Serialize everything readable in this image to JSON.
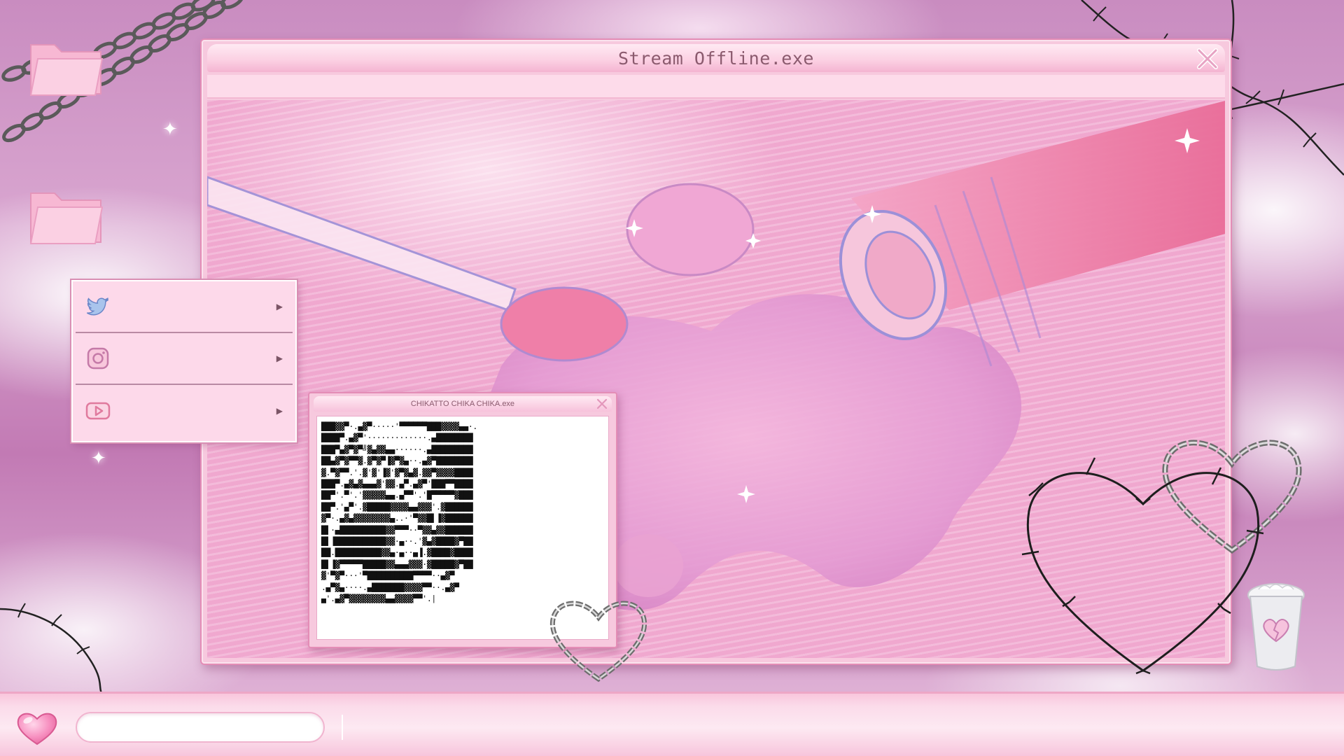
{
  "main_window": {
    "title": "Stream Offline.exe",
    "close_icon": "close-icon"
  },
  "terminal_window": {
    "title": "CHIKATTO CHIKA CHIKA.exe",
    "close_icon": "close-icon",
    "ascii_art": "███▓▓▀·.▄▓▀·····'▀▀▀▀▀▀███▓▓▓▓▄▄·.\n████▀.▄▓▀'·············.▄████████\n███▀▄▓▀▓▀╝▓▄▓▓▄▄······.▄█████████\n██▄▓▀▓▀▀▓.▓▀▓▀▐▓▀▓▄··.▄▓▀████████\n▓.▀▓▀▀.'.▓'▓'▐▓'▓▀▓▄▓.▓▓▀▓▓▓▓████\n███▀.▄▓▄▓▄▄▄▓'▓▓.▄▀.▄▓▀'███▀▀████\n██▀'.▀'.'▓▓▓▓▓▄▄.▄▀▀'.'█▀▀▀▀▀▓███\n██▀.'▄▀'.▓█████▓▓▓▓▄▄▓▓▓'.▓██████\n▓▀·.▄▓▄▓▓▓▓▓▓▓▓▄..·'▀▓▓█▌▐▓██████\n█▌·▄██████████▓▓▀▀▀··▀▓▓▄▓▓██████\n█▌▐███████████▓▓·▄··.'▓▄▓████▓▀██\n██.██████████▓▓▄·▄··▄▐.▓████▓████\n█▌▐▓▀▀▀▀▀█████▓▓▄▄▄▓▓▓·▓█████▓▀██\n▓'▀▓▀···'▀██████████▀▀▀▀··▄▓▀\n.▄▀▓▄····.▄███████▓▓▓▓▀▀··.▄▓▀\n▄'.▄▓▀▓▓▓▓▓▓▓▓▄▄▓▓▓▓▀▀'.|"
  },
  "social_menu": {
    "items": [
      {
        "icon": "twitter-icon",
        "label": ""
      },
      {
        "icon": "instagram-icon",
        "label": ""
      },
      {
        "icon": "youtube-icon",
        "label": ""
      }
    ],
    "arrow_icon": "submenu-arrow-icon"
  },
  "desktop": {
    "icons": [
      "folder-icon",
      "folder-icon",
      "trash-icon"
    ]
  },
  "taskbar": {
    "start_icon": "heart-icon",
    "search_value": "",
    "search_placeholder": ""
  },
  "colors": {
    "window_pink": "#f7c9de",
    "window_border": "#e48db6",
    "title_text": "#8b5a6e",
    "taskbar_pink": "#fbdbea"
  }
}
